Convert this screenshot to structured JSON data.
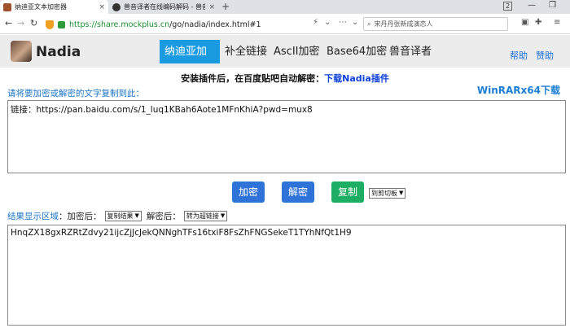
{
  "browser": {
    "tabs": [
      {
        "title": "纳迪亚文本加密器",
        "close": "×"
      },
      {
        "title": "兽音译者在线编码解码 - 兽音…",
        "close": "×"
      }
    ],
    "new_tab": "+",
    "window_buttons": [
      "2",
      "—",
      "❐"
    ],
    "url_host": "https://share.mockplus.cn",
    "url_path": "/go/nadia/index.html#1",
    "search_placeholder": "宋丹丹张新成演恋人"
  },
  "header": {
    "logo_text": "Nadia",
    "nav_tabs": [
      {
        "label": "纳迪亚加密",
        "active": true
      },
      {
        "label": "补全链接",
        "active": false
      },
      {
        "label": "AscII加密",
        "active": false
      },
      {
        "label": "Base64加密",
        "active": false
      },
      {
        "label": "兽音译者",
        "active": false
      }
    ],
    "help": "帮助",
    "sponsor": "赞助"
  },
  "content": {
    "notice_text": "安装插件后，在百度贴吧自动解密：",
    "notice_link": "下载Nadia插件",
    "prompt": "请将要加密或解密的文字复制到此：",
    "winrar_link": "WinRARx64下载",
    "input_value": "链接：https://pan.baidu.com/s/1_luq1KBah6Aote1MFnKhiA?pwd=mux8",
    "buttons": {
      "encrypt": "加密",
      "decrypt": "解密",
      "copy": "复制"
    },
    "copy_target": "到剪切板",
    "result_label": "结果显示区域",
    "after_encrypt_label": "：加密后：",
    "after_encrypt_option": "复制结果",
    "after_decrypt_label": "解密后：",
    "after_decrypt_option": "转为超链接",
    "output_value": "HnqZX18gxRZRtZdvy21ijcZjJcJekQNNghTFs16txiF8FsZhFNGSekeT1TYhNfQt1H9"
  }
}
